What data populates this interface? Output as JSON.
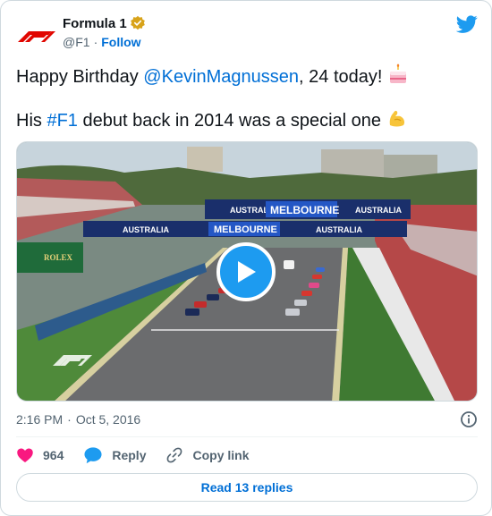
{
  "author": {
    "display_name": "Formula 1",
    "handle": "@F1",
    "separator": "·",
    "follow_label": "Follow",
    "verified_icon": "verified-badge-icon",
    "avatar_icon": "f1-logo-icon",
    "platform_icon": "twitter-bird-icon"
  },
  "tweet": {
    "line1_prefix": "Happy Birthday ",
    "line1_mention": "@KevinMagnussen",
    "line1_suffix": ", 24 today! ",
    "line1_emoji": "birthday-cake-icon",
    "line2_prefix": "His ",
    "line2_hashtag": "#F1",
    "line2_suffix": " debut back in 2014 was a special one ",
    "line2_emoji": "flexed-biceps-icon"
  },
  "media": {
    "banner_top_left": "AUSTRALIA",
    "banner_top_center": "MELBOURNE",
    "banner_top_right": "AUSTRALIA",
    "banner_low_left": "AUSTRALIA",
    "banner_low_center": "MELBOURNE",
    "banner_low_right": "AUSTRALIA",
    "sponsor": "ROLEX",
    "play_icon": "play-icon"
  },
  "meta": {
    "time": "2:16 PM",
    "separator": "·",
    "date": "Oct 5, 2016"
  },
  "actions": {
    "like_count": "964",
    "reply_label": "Reply",
    "copy_label": "Copy link"
  },
  "footer": {
    "read_replies_label": "Read 13 replies"
  },
  "colors": {
    "link": "#006fd6",
    "like": "#f91880",
    "play": "#1d9bf0",
    "muted": "#536471"
  }
}
